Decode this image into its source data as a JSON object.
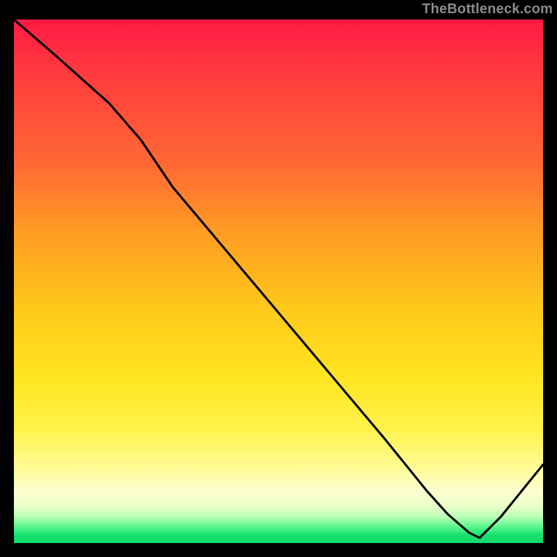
{
  "attribution": "TheBottleneck.com",
  "label": {
    "text": ""
  },
  "colors": {
    "page_bg": "#000000",
    "curve": "#000000",
    "attribution_text": "#8b8b8b",
    "label_text": "#e03a2a",
    "gradient_top": "#ff1a44",
    "gradient_bottom": "#12d867"
  },
  "chart_data": {
    "type": "line",
    "title": "",
    "xlabel": "",
    "ylabel": "",
    "xlim": [
      0,
      100
    ],
    "ylim": [
      0,
      100
    ],
    "grid": false,
    "legend": false,
    "series": [
      {
        "name": "curve",
        "x": [
          0,
          8,
          18,
          24,
          30,
          40,
          50,
          60,
          70,
          78,
          82,
          86,
          88,
          92,
          100
        ],
        "values": [
          100,
          93,
          84,
          77,
          68,
          56,
          44,
          32,
          20,
          10,
          5.5,
          2,
          1,
          5,
          15
        ]
      }
    ],
    "notes": "Values are estimated from pixel positions; y=0 is the bottom edge of the colored plot area, y=100 is the top edge. The curve falls from top-left, reaches a minimum near x≈88 at the green band, then rises toward the right edge."
  }
}
